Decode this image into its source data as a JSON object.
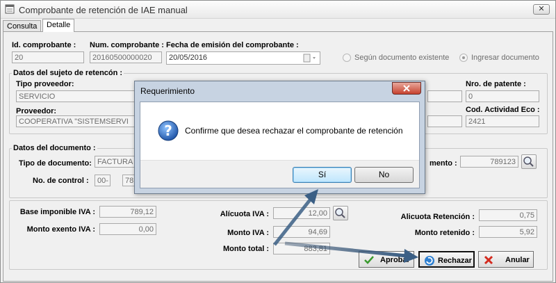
{
  "window": {
    "title": "Comprobante de retención de IAE manual",
    "close_label": "✕"
  },
  "tabs": [
    {
      "label": "Consulta"
    },
    {
      "label": "Detalle"
    }
  ],
  "header": {
    "id_label": "Id. comprobante :",
    "id_value": "20",
    "num_label": "Num. comprobante :",
    "num_value": "20160500000020",
    "fecha_label": "Fecha de emisión del comprobante :",
    "fecha_value": "20/05/2016",
    "radio1_label": "Según documento existente",
    "radio2_label": "Ingresar documento"
  },
  "sujeto": {
    "group_title": "Datos del sujeto de retencón :",
    "tipo_label": "Tipo proveedor:",
    "tipo_value": "SERVICIO",
    "prov_label": "Proveedor:",
    "prov_value": "COOPERATIVA \"SISTEMSERVI",
    "patente_label": "Nro. de patente :",
    "patente_value": "0",
    "actividad_label": "Cod. Actividad Eco :",
    "actividad_value": "2421"
  },
  "documento": {
    "group_title": "Datos del documento :",
    "tipo_label": "Tipo de documento:",
    "tipo_value": "FACTURA",
    "control_label": "No. de control :",
    "control_part1": "00-",
    "control_part2": "78",
    "numdoc_label": "mento :",
    "numdoc_value": "789123"
  },
  "montos": {
    "base_label": "Base imponible IVA :",
    "base_value": "789,12",
    "exento_label": "Monto exento IVA :",
    "exento_value": "0,00",
    "alicuota_label": "Alícuota IVA :",
    "alicuota_value": "12,00",
    "montoiva_label": "Monto IVA :",
    "montoiva_value": "94,69",
    "total_label": "Monto total :",
    "total_value": "883,81",
    "alicret_label": "Alicuota Retención :",
    "alicret_value": "0,75",
    "retenido_label": "Monto retenido :",
    "retenido_value": "5,92"
  },
  "actions": {
    "aprobar_label": "Aprobar",
    "rechazar_label": "Rechazar",
    "anular_label": "Anular"
  },
  "dialog": {
    "title": "Requerimiento",
    "message": "Confirme que desea rechazar el comprobante de retención",
    "yes_label": "Sí",
    "no_label": "No"
  },
  "colors": {
    "arrow": "#3b5f85",
    "dialog_frame": "#c7d3e2",
    "close_red": "#c7422f"
  }
}
